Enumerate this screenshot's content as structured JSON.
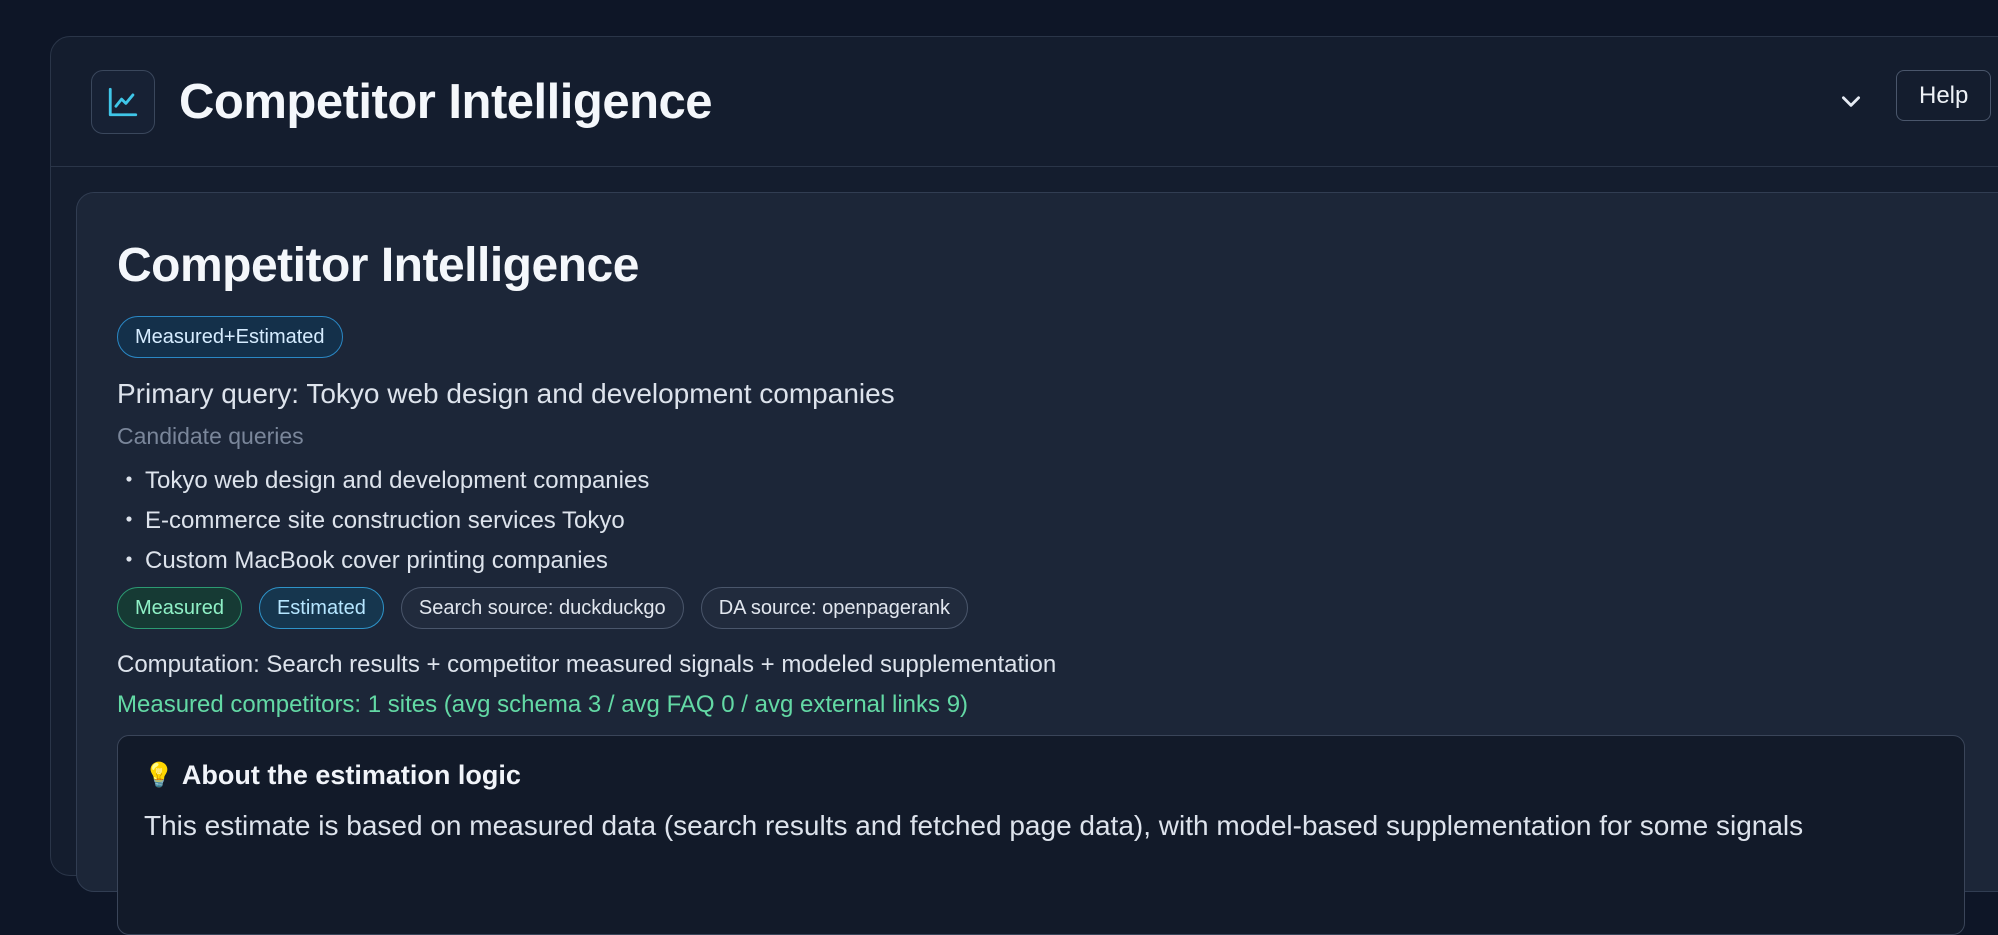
{
  "header": {
    "title": "Competitor Intelligence",
    "icon": "line-chart-icon",
    "collapse_icon": "chevron-down-icon",
    "help_label": "Help"
  },
  "card": {
    "title": "Competitor Intelligence",
    "mode_badge": "Measured+Estimated",
    "primary_query": "Primary query: Tokyo web design and development companies",
    "candidate_queries_label": "Candidate queries",
    "candidate_bullet": "・",
    "candidate_queries": [
      "Tokyo web design and development companies",
      "E-commerce site construction services Tokyo",
      "Custom MacBook cover printing companies"
    ],
    "tags": {
      "measured": "Measured",
      "estimated": "Estimated",
      "search_source": "Search source: duckduckgo",
      "da_source": "DA source: openpagerank"
    },
    "computation": "Computation: Search results + competitor measured signals + modeled supplementation",
    "measured_competitors": "Measured competitors: 1 sites (avg schema 3 / avg FAQ 0 / avg external links 9)",
    "about": {
      "icon": "lightbulb-icon",
      "title": "About the estimation logic",
      "text": "This estimate is based on measured data (search results and fetched page data), with model-based supplementation for some signals"
    }
  },
  "colors": {
    "background": "#0e1627",
    "accent_cyan": "#3fc6e8",
    "measured_green": "#63d9a5",
    "estimated_blue": "#2e93c8"
  }
}
